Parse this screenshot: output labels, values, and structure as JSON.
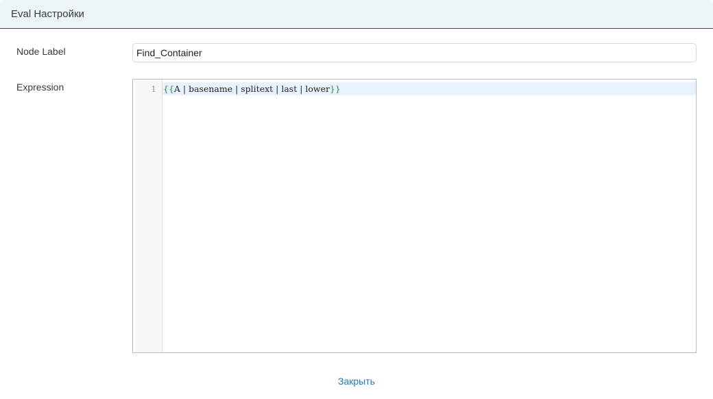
{
  "dialog": {
    "title": "Eval Настройки"
  },
  "form": {
    "node_label": {
      "label": "Node Label",
      "value": "Find_Container"
    },
    "expression": {
      "label": "Expression",
      "line_number": "1",
      "code": {
        "open_brace": "{{",
        "body": "A | basename | splitext | last | lower",
        "close_brace": "}}"
      }
    }
  },
  "footer": {
    "close_label": "Закрыть"
  },
  "colors": {
    "header_bg": "#eef5f8",
    "accent_link": "#1f7ab8",
    "brace": "#2e8b2e",
    "active_line": "#e8f2ff"
  }
}
